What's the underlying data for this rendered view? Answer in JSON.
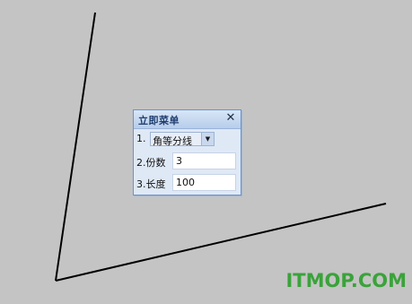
{
  "panel": {
    "title": "立即菜单",
    "close_symbol": "✕",
    "rows": [
      {
        "label": "1.",
        "value": "角等分线",
        "dropdown_icon": "chevron-down-icon"
      },
      {
        "label": "2.份数",
        "value": "3"
      },
      {
        "label": "3.长度",
        "value": "100"
      }
    ]
  },
  "watermark": "ITMOP.COM",
  "colors": {
    "background": "#c4c4c4",
    "panel_title": "#1e3d6e",
    "watermark": "#3aa33a"
  }
}
